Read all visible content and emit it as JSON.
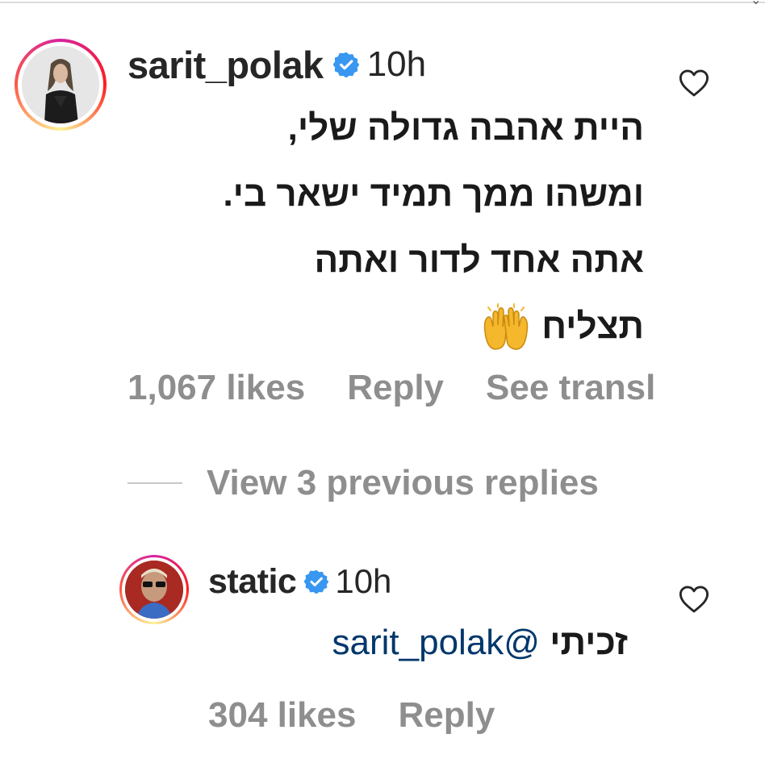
{
  "comment": {
    "username": "sarit_polak",
    "time": "10h",
    "text_lines": [
      "היית אהבה גדולה שלי,",
      "ומשהו ממך תמיד ישאר בי.",
      "אתה אחד לדור ואתה",
      "תצליח"
    ],
    "emoji": "raising-hands-emoji",
    "likes": "1,067 likes",
    "reply_label": "Reply",
    "see_translation": "See transl"
  },
  "view_replies": {
    "label": "View 3 previous replies"
  },
  "reply": {
    "username": "static",
    "time": "10h",
    "mention": "@sarit_polak",
    "text": "זכיתי",
    "likes": "304 likes",
    "reply_label": "Reply"
  },
  "colors": {
    "verified": "#3897f0",
    "muted": "#8e8e8e",
    "mention": "#00376b",
    "text": "#262626"
  }
}
